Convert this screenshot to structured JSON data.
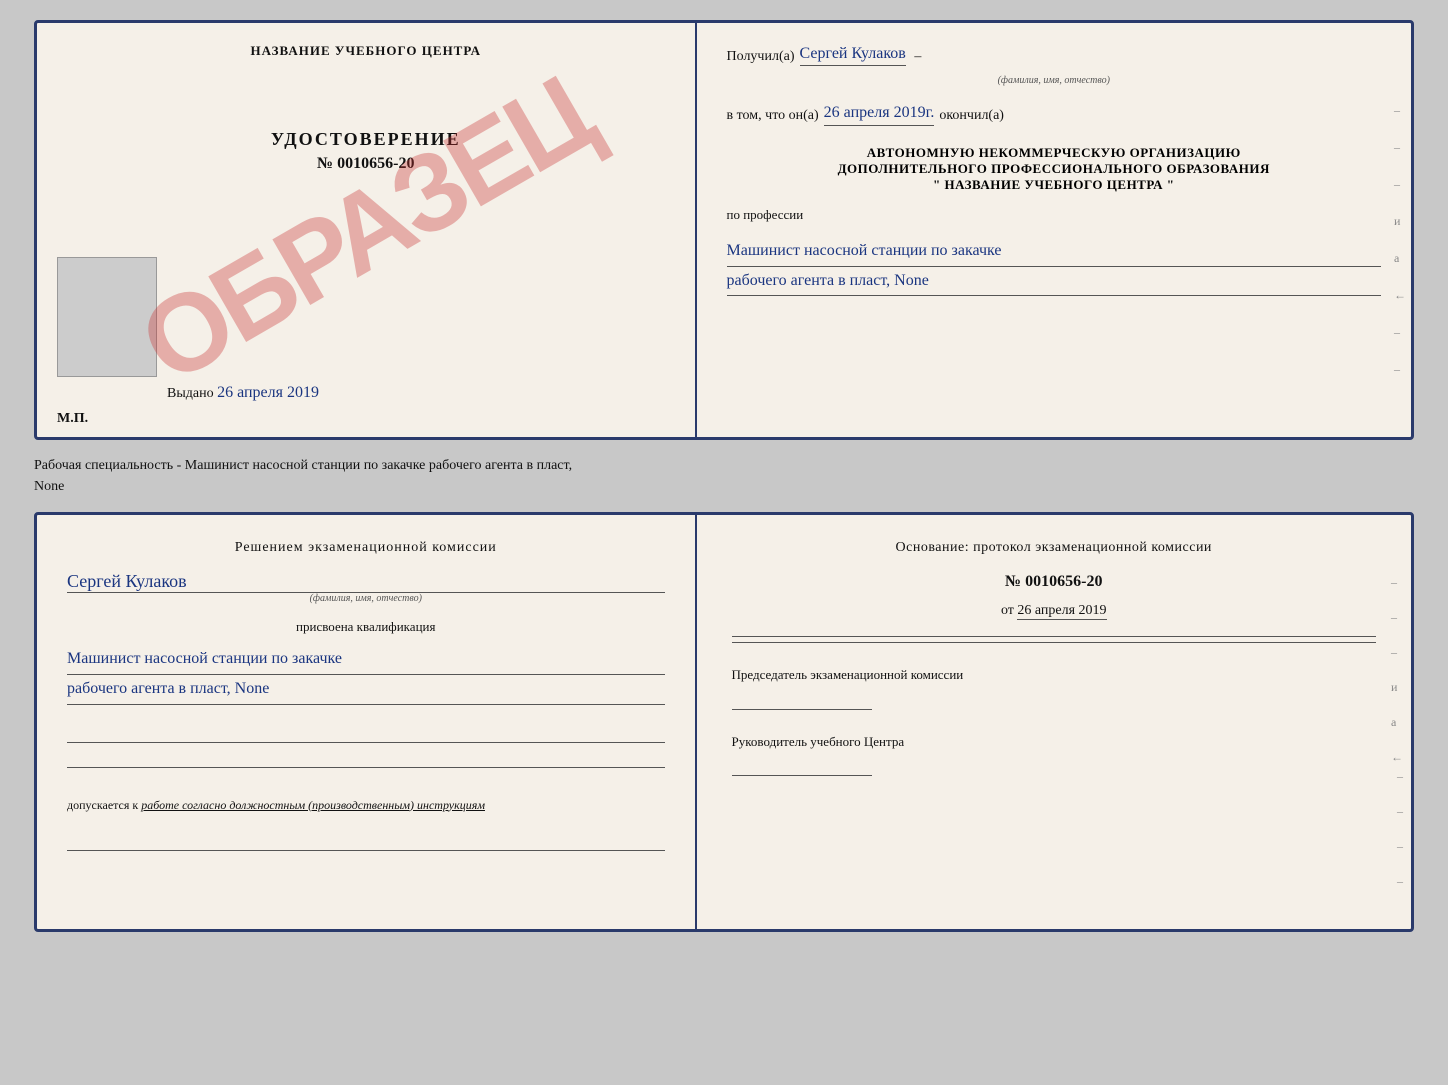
{
  "top_left": {
    "center_title": "НАЗВАНИЕ УЧЕБНОГО ЦЕНТРА",
    "watermark": "ОБРАЗЕЦ",
    "udostoverenie_title": "УДОСТОВЕРЕНИЕ",
    "number": "№ 0010656-20",
    "vydano_label": "Выдано",
    "vydano_date": "26 апреля 2019",
    "mp_label": "М.П."
  },
  "top_right": {
    "poluchil_label": "Получил(а)",
    "poluchil_value": "Сергей Кулаков",
    "familiya_hint": "(фамилия, имя, отчество)",
    "v_tom_label": "в том, что он(а)",
    "v_tom_date": "26 апреля 2019г.",
    "okonchil_label": "окончил(а)",
    "org_line1": "АВТОНОМНУЮ НЕКОММЕРЧЕСКУЮ ОРГАНИЗАЦИЮ",
    "org_line2": "ДОПОЛНИТЕЛЬНОГО ПРОФЕССИОНАЛЬНОГО ОБРАЗОВАНИЯ",
    "org_line3": "\" НАЗВАНИЕ УЧЕБНОГО ЦЕНТРА \"",
    "po_professii": "по профессии",
    "profession_line1": "Машинист насосной станции по закачке",
    "profession_line2": "рабочего агента в пласт, None"
  },
  "between_text": {
    "line1": "Рабочая специальность - Машинист насосной станции по закачке рабочего агента в пласт,",
    "line2": "None"
  },
  "bottom_left": {
    "komissia_title": "Решением экзаменационной комиссии",
    "person_name": "Сергей Кулаков",
    "familiya_hint": "(фамилия, имя, отчество)",
    "prisvoena": "присвоена квалификация",
    "qual_line1": "Машинист насосной станции по закачке",
    "qual_line2": "рабочего агента в пласт, None",
    "dopuskaetsya": "допускается к",
    "dopuskaetsya_value": "работе согласно должностным (производственным) инструкциям"
  },
  "bottom_right": {
    "osnovanie_title": "Основание: протокол экзаменационной комиссии",
    "number": "№ 0010656-20",
    "ot_label": "от",
    "ot_date": "26 апреля 2019",
    "predsedatel_label": "Председатель экзаменационной комиссии",
    "rukovoditel_label": "Руководитель учебного Центра"
  },
  "side_marks": {
    "items": [
      "-",
      "-",
      "-",
      "и",
      "а",
      "←",
      "-",
      "-",
      "-"
    ]
  }
}
